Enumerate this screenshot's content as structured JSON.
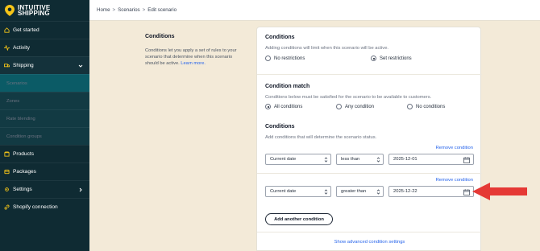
{
  "brand": {
    "line1": "INTUITIVE",
    "line2": "SHIPPING",
    "accent_color": "#f5c518"
  },
  "sidebar": {
    "items": [
      {
        "label": "Get started",
        "icon": "home-icon"
      },
      {
        "label": "Activity",
        "icon": "activity-icon"
      },
      {
        "label": "Shipping",
        "icon": "truck-icon",
        "expanded": true
      },
      {
        "label": "Scenarios",
        "sub": true
      },
      {
        "label": "Zones",
        "sub": true
      },
      {
        "label": "Rate blending",
        "sub": true
      },
      {
        "label": "Condition groups",
        "sub": true
      },
      {
        "label": "Products",
        "icon": "box-icon"
      },
      {
        "label": "Packages",
        "icon": "package-icon"
      },
      {
        "label": "Settings",
        "icon": "gear-icon"
      },
      {
        "label": "Shopify connection",
        "icon": "link-icon"
      }
    ]
  },
  "breadcrumb": [
    "Home",
    "Scenarios",
    "Edit scenario"
  ],
  "breadcrumb_sep": ">",
  "description": {
    "title": "Conditions",
    "body": "Conditions let you apply a set of rules to your scenario that determine when this scenario should be active.",
    "link": "Learn more."
  },
  "conditions": {
    "title": "Conditions",
    "subtitle": "Adding conditions will limit when this scenario will be active.",
    "options": [
      "No restrictions",
      "Set restrictions"
    ],
    "selected": "Set restrictions"
  },
  "match": {
    "title": "Condition match",
    "subtitle": "Conditions below must be satisfied for the scenario to be available to customers.",
    "options": [
      "All conditions",
      "Any condition",
      "No conditions"
    ],
    "selected": "All conditions"
  },
  "rules": {
    "title": "Conditions",
    "subtitle": "Add conditions that will determine the scenario status.",
    "remove_label": "Remove condition",
    "items": [
      {
        "field": "Current date",
        "operator": "less than",
        "value": "2025-12-01"
      },
      {
        "field": "Current date",
        "operator": "greater than",
        "value": "2025-12-22"
      }
    ],
    "add_label": "Add another condition",
    "advanced_label": "Show advanced condition settings"
  },
  "annotation_color": "#e53935"
}
